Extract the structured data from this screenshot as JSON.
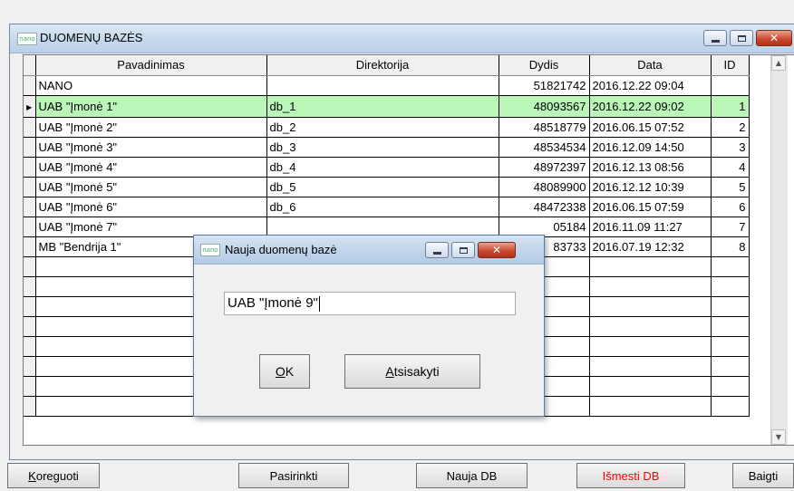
{
  "main_window": {
    "icon_text": "nano",
    "title": "DUOMENŲ BAZĖS"
  },
  "grid": {
    "columns": [
      "Pavadinimas",
      "Direktorija",
      "Dydis",
      "Data",
      "ID"
    ],
    "rows": [
      {
        "name": "NANO",
        "dir": "",
        "size": "51821742",
        "date": "2016.12.22 09:04",
        "id": ""
      },
      {
        "name": "UAB \"Įmonė 1\"",
        "dir": "db_1",
        "size": "48093567",
        "date": "2016.12.22 09:02",
        "id": "1"
      },
      {
        "name": "UAB \"Įmonė 2\"",
        "dir": "db_2",
        "size": "48518779",
        "date": "2016.06.15 07:52",
        "id": "2"
      },
      {
        "name": "UAB \"Įmonė 3\"",
        "dir": "db_3",
        "size": "48534534",
        "date": "2016.12.09 14:50",
        "id": "3"
      },
      {
        "name": "UAB \"Įmonė 4\"",
        "dir": "db_4",
        "size": "48972397",
        "date": "2016.12.13 08:56",
        "id": "4"
      },
      {
        "name": "UAB \"Įmonė 5\"",
        "dir": "db_5",
        "size": "48089900",
        "date": "2016.12.12 10:39",
        "id": "5"
      },
      {
        "name": "UAB \"Įmonė 6\"",
        "dir": "db_6",
        "size": "48472338",
        "date": "2016.06.15 07:59",
        "id": "6"
      },
      {
        "name": "UAB \"Įmonė 7\"",
        "dir": "",
        "size": "05184",
        "date": "2016.11.09 11:27",
        "id": "7"
      },
      {
        "name": "MB \"Bendrija 1\"",
        "dir": "",
        "size": "83733",
        "date": "2016.07.19 12:32",
        "id": "8"
      }
    ],
    "selected_row": 1
  },
  "dialog": {
    "icon_text": "nano",
    "title": "Nauja duomenų bazė",
    "input_value": "UAB \"Įmonė 9\"",
    "ok_hotkey": "O",
    "ok_rest": "K",
    "cancel_hotkey": "A",
    "cancel_rest": "tsisakyti"
  },
  "buttons": {
    "edit_hotkey": "K",
    "edit_rest": "oreguoti",
    "select": "Pasirinkti",
    "new_db": "Nauja DB",
    "delete_db": "Išmesti DB",
    "finish": "Baigti"
  },
  "colors": {
    "selected_row": "#b9f6b7",
    "delete_button_text": "#ff0000"
  }
}
